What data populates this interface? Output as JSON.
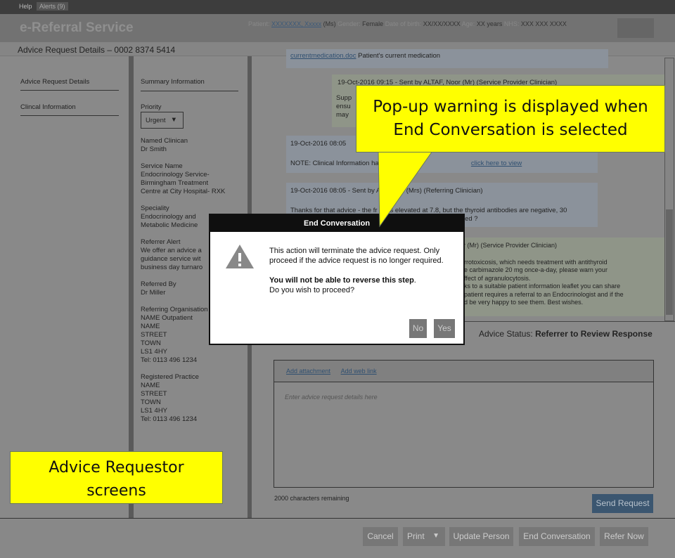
{
  "topbar": {
    "help": "Help",
    "alerts": "Alerts (9)"
  },
  "header": {
    "title": "e-Referral Service",
    "patient_label": "Patient:",
    "patient_name": "XXXXXXX, Xxxxx",
    "patient_title": "(Ms)",
    "gender_label": "Gender:",
    "gender": "Female",
    "dob_label": "Date of birth:",
    "dob": "XX/XX/XXXX",
    "age_label": "Age:",
    "age": "XX years",
    "nhs_label": "NHS:",
    "nhs": "XXX XXX XXXX"
  },
  "subheader": {
    "title": "Advice Request Details – 0002 8374 5414"
  },
  "nav": {
    "items": [
      "Advice Request Details",
      "Clincal Information"
    ]
  },
  "summary": {
    "title": "Summary Information",
    "priority_label": "Priority",
    "priority_value": "Urgent",
    "fields": [
      {
        "label": "Named Clinican",
        "lines": [
          "Dr Smith"
        ]
      },
      {
        "label": "Service Name",
        "lines": [
          "Endocrinology Service-",
          "Birmingham Treatment",
          "Centre at City Hospital- RXK"
        ]
      },
      {
        "label": "Speciality",
        "lines": [
          "Endocrinology and",
          "Metabolic Medicine"
        ]
      },
      {
        "label": "Referrer Alert",
        "lines": [
          "We offer an advice a",
          "guidance service wit",
          "business day turnaro"
        ]
      },
      {
        "label": "Referred By",
        "lines": [
          "Dr Miller"
        ]
      },
      {
        "label": "Referring Organisation",
        "lines": [
          "NAME Outpatient",
          "NAME",
          "STREET",
          "TOWN",
          "LS1 4HY",
          "Tel: 0113 496 1234"
        ]
      },
      {
        "label": "Registered Practice",
        "lines": [
          "NAME",
          "STREET",
          "TOWN",
          "LS1 4HY",
          "Tel: 0113 496 1234"
        ]
      }
    ]
  },
  "messages": [
    {
      "link": "currentmedication.doc",
      "text": "Patient's current medication"
    },
    {
      "header": "19-Oct-2016 09:15 - Sent by ALTAF, Noor (Mr) (Service Provider Clinician)",
      "lines": [
        "Supp",
        "ensu",
        "may"
      ]
    },
    {
      "header": "19-Oct-2016 08:05",
      "text": "NOTE: Clinical Information has bee",
      "link": "click here to view"
    },
    {
      "header": "19-Oct-2016 08:05 - Sent by Al          n (Mrs) (Referring Clinician)",
      "lines": [
        "Thanks for that advice - the fr      is elevated at 7.8, but the thyroid antibodies are negative, 30",
        "                                                                                              ed ?"
      ]
    },
    {
      "header": "or (Mr) (Service Provider Clinician)",
      "lines": [
        "rrotoxicosis, which needs treatment with antithyroid",
        "e carbimazole 20 mg once-a-day, please warn your",
        "ffect of agranulocytosis.",
        "ks to a suitable patient information leaflet you can share",
        "patient requires a referral to an Endocrinologist and if the",
        "d be very happy to see them. Best wishes."
      ]
    }
  ],
  "status": {
    "label": "Advice Status:",
    "value": "Referrer to Review Response"
  },
  "composer": {
    "add_attachment": "Add attachment",
    "add_web_link": "Add web link",
    "placeholder": "Enter advice request details here",
    "remaining": "2000 characters remaining",
    "send": "Send Request"
  },
  "footer": {
    "buttons": [
      "Cancel",
      "Print",
      "Update Person",
      "End Conversation",
      "Refer Now"
    ]
  },
  "dialog": {
    "title": "End Conversation",
    "line1": "This action will terminate the advice request. Only proceed if the advice request is no longer required.",
    "bold": "You will not be able to reverse this step",
    "after_bold": ".",
    "line3": "Do you wish to proceed?",
    "no": "No",
    "yes": "Yes"
  },
  "annotations": {
    "callout": "Pop-up warning is displayed when End Conversation is selected",
    "box": "Advice Requestor screens"
  },
  "colors": {
    "callout": "#ffff00",
    "send_button": "#3b5670",
    "dialog_header": "#0f0f0f"
  }
}
